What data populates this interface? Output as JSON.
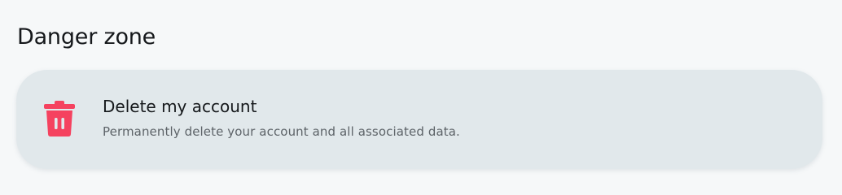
{
  "section": {
    "title": "Danger zone"
  },
  "delete_account": {
    "title": "Delete my account",
    "description": "Permanently delete your account and all associated data.",
    "icon": "trash-icon",
    "icon_color": "#f5425f"
  },
  "colors": {
    "background": "#f6f8f9",
    "card": "#e1e8eb",
    "danger": "#f5425f"
  }
}
